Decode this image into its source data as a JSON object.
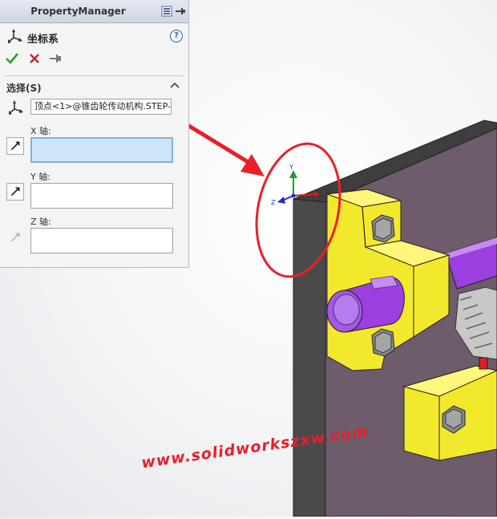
{
  "panel": {
    "title": "PropertyManager",
    "feature_title": "坐标系",
    "help_icon_text": "?",
    "section_title": "选择(S)",
    "origin_value": "顶点<1>@锥齿轮传动机构.STEP-",
    "x_axis_label": "X 轴:",
    "y_axis_label": "Y 轴:",
    "z_axis_label": "Z 轴:",
    "x_axis_value": "",
    "y_axis_value": "",
    "z_axis_value": ""
  },
  "viewport": {
    "triad_labels": {
      "y": "Y",
      "z": "Z"
    },
    "watermark": "www.solidworkszxw.com"
  },
  "colors": {
    "plate": "#6e5c6c",
    "plate_edge": "#3d3d3d",
    "bracket": "#f3e92c",
    "shaft": "#9b3fe0",
    "callout": "#e8202a",
    "active_field": "#cde5f7"
  }
}
